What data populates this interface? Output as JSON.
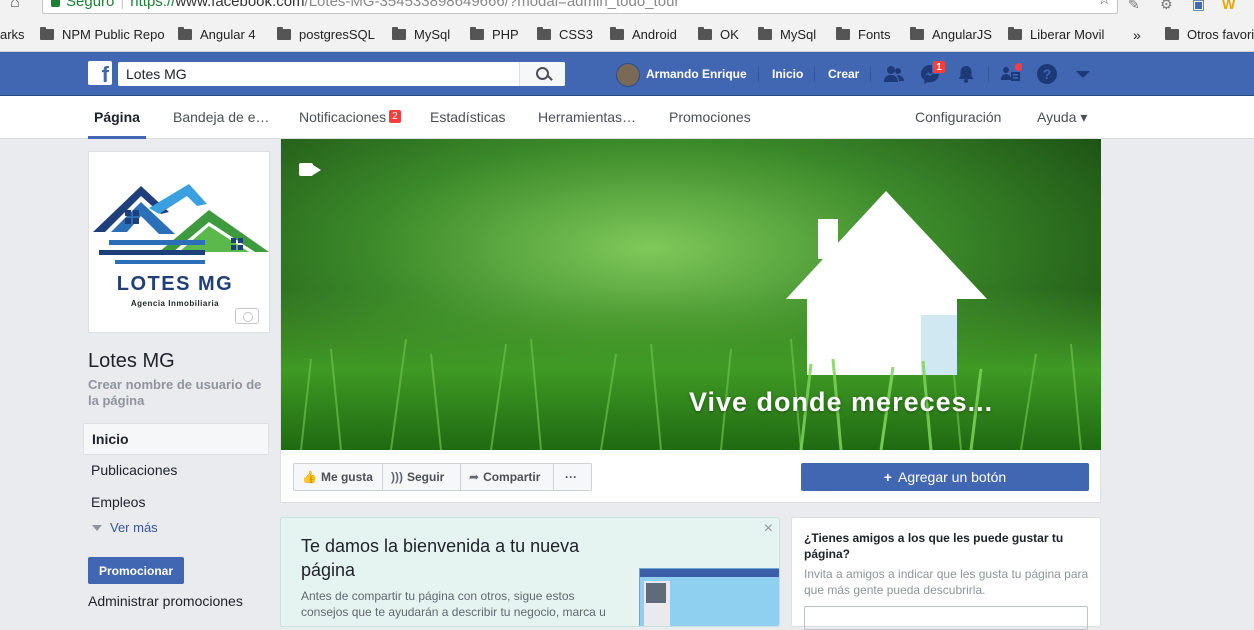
{
  "browser": {
    "secure_label": "Seguro",
    "url_scheme": "https://",
    "url_host": "www.facebook.com",
    "url_path": "/Lotes-MG-354533898649666/?modal=admin_todo_tour",
    "bookmarks": [
      {
        "label": "arks",
        "folder": false
      },
      {
        "label": "NPM Public Repo",
        "folder": true
      },
      {
        "label": "Angular 4",
        "folder": true
      },
      {
        "label": "postgresSQL",
        "folder": true
      },
      {
        "label": "MySql",
        "folder": true
      },
      {
        "label": "PHP",
        "folder": true
      },
      {
        "label": "CSS3",
        "folder": true
      },
      {
        "label": "Android",
        "folder": true
      },
      {
        "label": "OK",
        "folder": true
      },
      {
        "label": "MySql",
        "folder": true
      },
      {
        "label": "Fonts",
        "folder": true
      },
      {
        "label": "AngularJS",
        "folder": true
      },
      {
        "label": "Liberar Movil",
        "folder": true
      }
    ],
    "bookmarks_overflow": "»",
    "other_bookmarks": "Otros favoritos"
  },
  "topbar": {
    "search_value": "Lotes MG",
    "user_name": "Armando Enrique",
    "home_label": "Inicio",
    "create_label": "Crear",
    "messages_badge": "1",
    "icons": [
      "friend-requests-icon",
      "messenger-icon",
      "notifications-icon",
      "page-manager-icon",
      "help-icon",
      "account-menu-icon"
    ]
  },
  "page_tabs": {
    "pagina": "Página",
    "inbox": "Bandeja de e…",
    "notifications": "Notificaciones",
    "notifications_badge": "2",
    "stats": "Estadísticas",
    "tools": "Herramientas…",
    "promotions": "Promociones",
    "settings": "Configuración",
    "help": "Ayuda ▾"
  },
  "left": {
    "logo_title": "LOTES MG",
    "logo_subtitle": "Agencia Inmobiliaria",
    "page_name": "Lotes MG",
    "create_username": "Crear nombre de usuario de la página",
    "nav": [
      "Inicio",
      "Publicaciones",
      "Empleos"
    ],
    "see_more": "Ver más",
    "promote": "Promocionar",
    "manage_promotions": "Administrar promociones"
  },
  "cover": {
    "tagline": "Vive donde mereces...",
    "like": "Me gusta",
    "follow": "Seguir",
    "share": "Compartir",
    "more": "···",
    "add_button": "Agregar un botón"
  },
  "welcome": {
    "title": "Te damos la bienvenida a tu nueva página",
    "body": "Antes de compartir tu página con otros, sigue estos consejos que te ayudarán a describir tu negocio, marca u",
    "close": "×"
  },
  "invite": {
    "title": "¿Tienes amigos a los que les puede gustar tu página?",
    "description": "Invita a amigos a indicar que les gusta tu página para que más gente pueda descubrirla."
  },
  "colors": {
    "fb_blue": "#4267b2",
    "link": "#365899",
    "badge_red": "#fa3e3e"
  }
}
